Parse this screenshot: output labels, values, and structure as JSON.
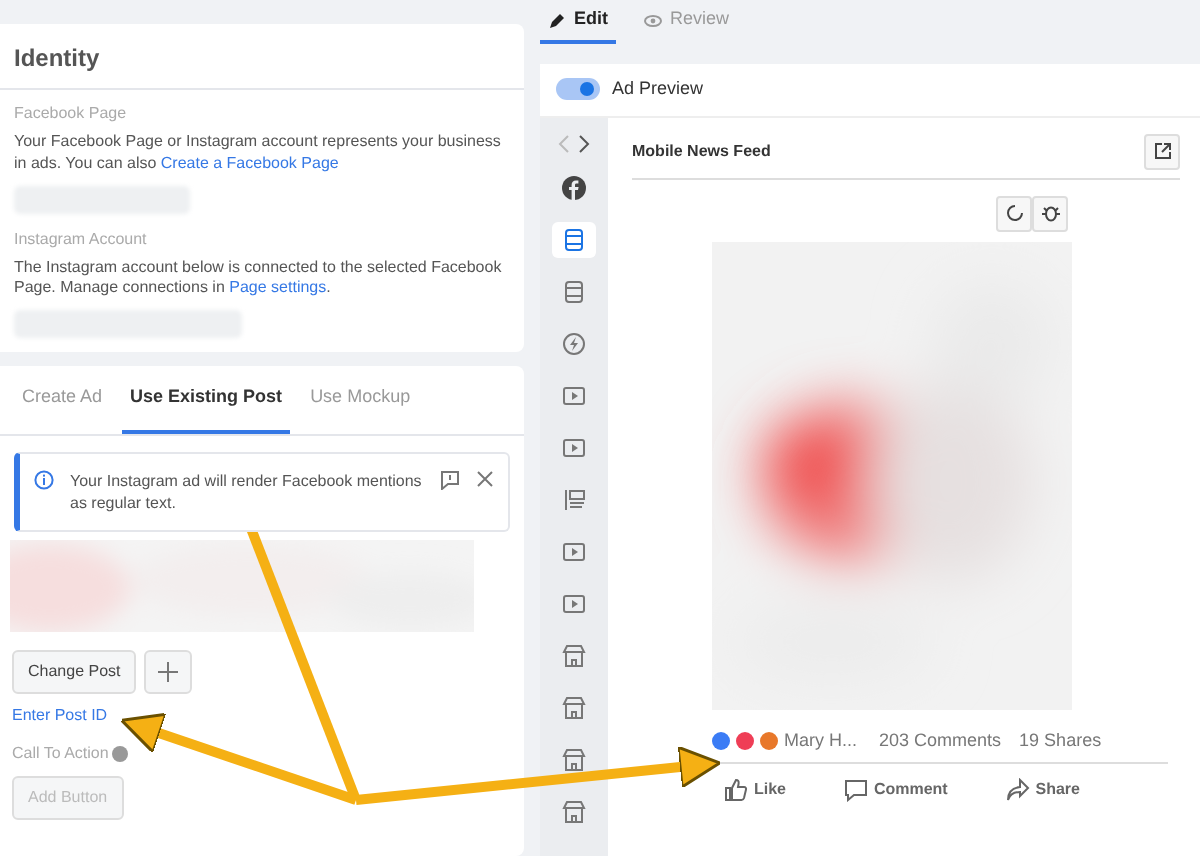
{
  "identity": {
    "title": "Identity",
    "facebook_page": {
      "label": "Facebook Page",
      "text": "Your Facebook Page or Instagram account represents your business in ads. You can also ",
      "link": "Create a Facebook Page"
    },
    "instagram_account": {
      "label": "Instagram Account",
      "text": "The Instagram account below is connected to the selected Facebook Page. Manage connections in ",
      "link": "Page settings",
      "after": "."
    }
  },
  "post_tabs": [
    {
      "label": "Create Ad",
      "selected": false
    },
    {
      "label": "Use Existing Post",
      "selected": true
    },
    {
      "label": "Use Mockup",
      "selected": false
    }
  ],
  "notice": {
    "text": "Your Instagram ad will render Facebook mentions as regular text."
  },
  "change_post": "Change Post",
  "enter_post_id": "Enter Post ID",
  "call_to_action": "Call To Action",
  "add_button": {
    "label": "Add Button",
    "disabled": true
  },
  "top_tabs": [
    {
      "label": "Edit",
      "kind": "edit",
      "selected": true
    },
    {
      "label": "Review",
      "kind": "review",
      "selected": false
    }
  ],
  "ad_preview": {
    "label": "Ad Preview",
    "on": true
  },
  "placements": [
    {
      "kind": "facebook",
      "selected": false
    },
    {
      "kind": "feed",
      "selected": true
    },
    {
      "kind": "feed",
      "selected": false
    },
    {
      "kind": "instant",
      "selected": false
    },
    {
      "kind": "video",
      "selected": false
    },
    {
      "kind": "video",
      "selected": false
    },
    {
      "kind": "list",
      "selected": false
    },
    {
      "kind": "video",
      "selected": false
    },
    {
      "kind": "video",
      "selected": false
    },
    {
      "kind": "shop",
      "selected": false
    },
    {
      "kind": "shop",
      "selected": false
    },
    {
      "kind": "shop",
      "selected": false
    },
    {
      "kind": "shop",
      "selected": false
    }
  ],
  "feed": {
    "title": "Mobile News Feed",
    "reactor": "Mary H...",
    "comments": "203 Comments",
    "shares": "19 Shares",
    "actions": [
      {
        "label": "Like",
        "kind": "like"
      },
      {
        "label": "Comment",
        "kind": "comment"
      },
      {
        "label": "Share",
        "kind": "share"
      }
    ]
  }
}
